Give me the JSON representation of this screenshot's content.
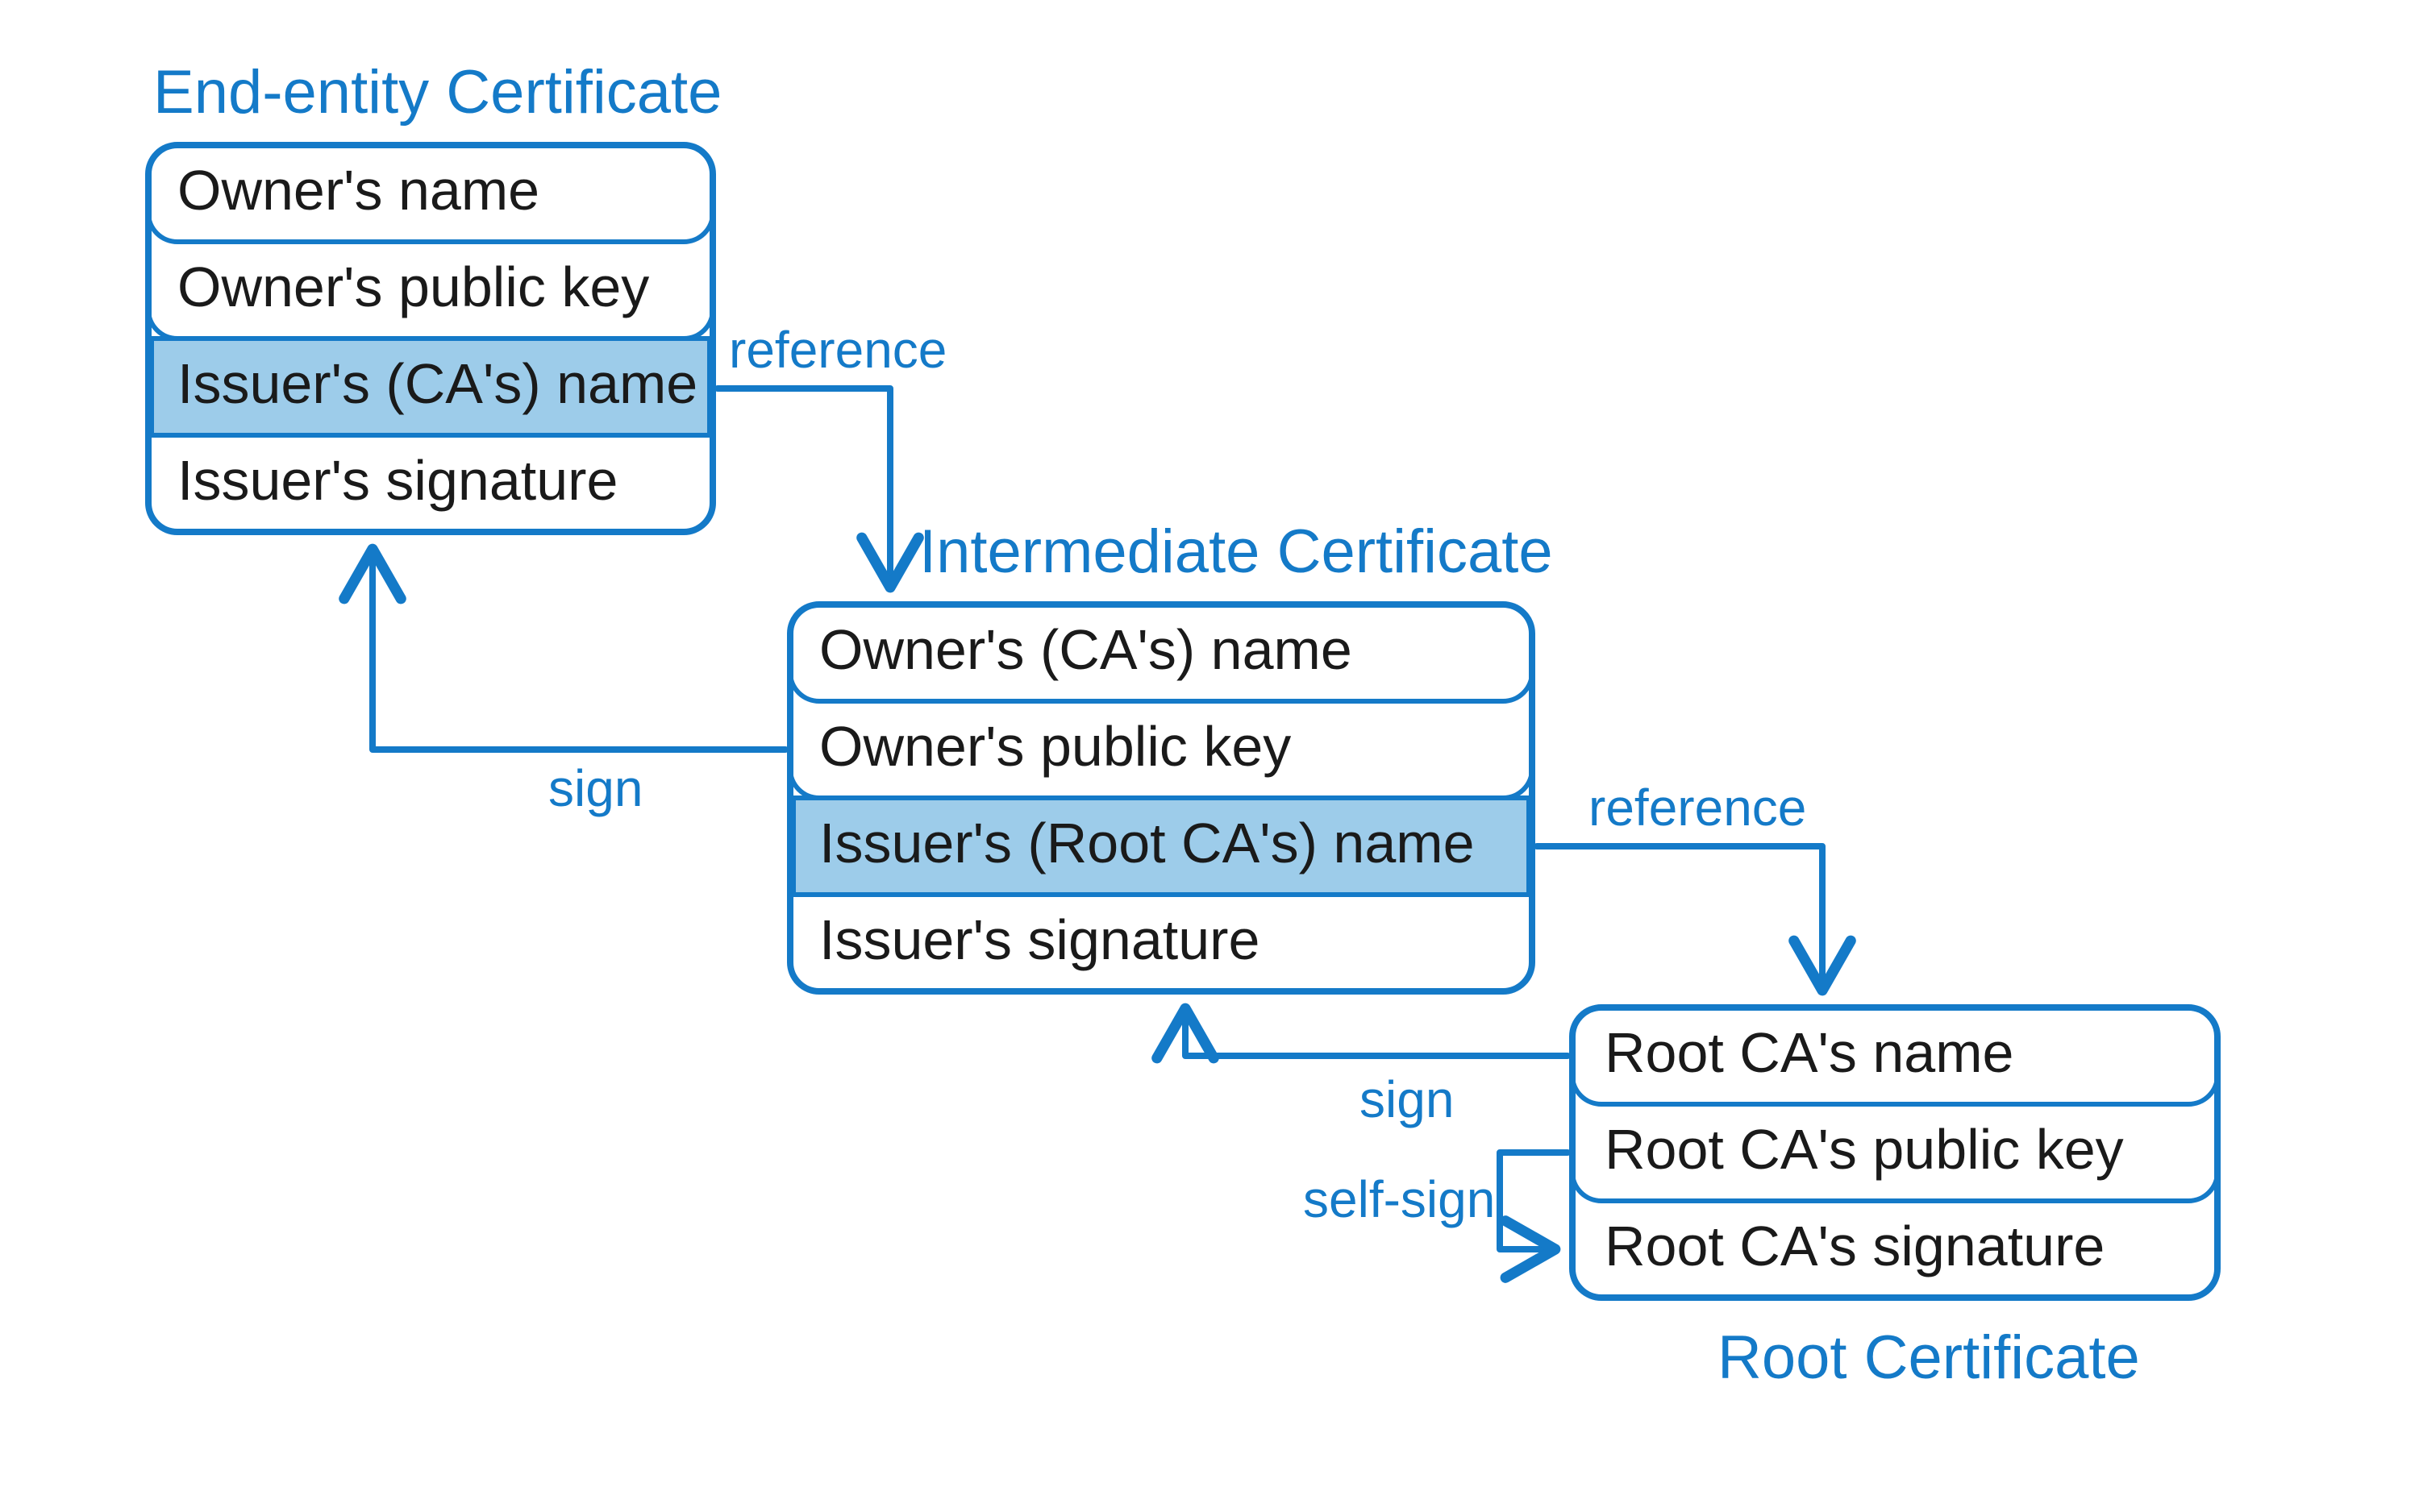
{
  "endEntity": {
    "title": "End-entity Certificate",
    "rows": [
      "Owner's name",
      "Owner's public key",
      "Issuer's (CA's) name",
      "Issuer's signature"
    ]
  },
  "intermediate": {
    "title": "Intermediate Certificate",
    "rows": [
      "Owner's (CA's) name",
      "Owner's public key",
      "Issuer's (Root CA's) name",
      "Issuer's signature"
    ]
  },
  "root": {
    "title": "Root Certificate",
    "rows": [
      "Root CA's name",
      "Root CA's public key",
      "Root CA's signature"
    ]
  },
  "labels": {
    "reference1": "reference",
    "reference2": "reference",
    "sign1": "sign",
    "sign2": "sign",
    "selfsign": "self-sign"
  }
}
